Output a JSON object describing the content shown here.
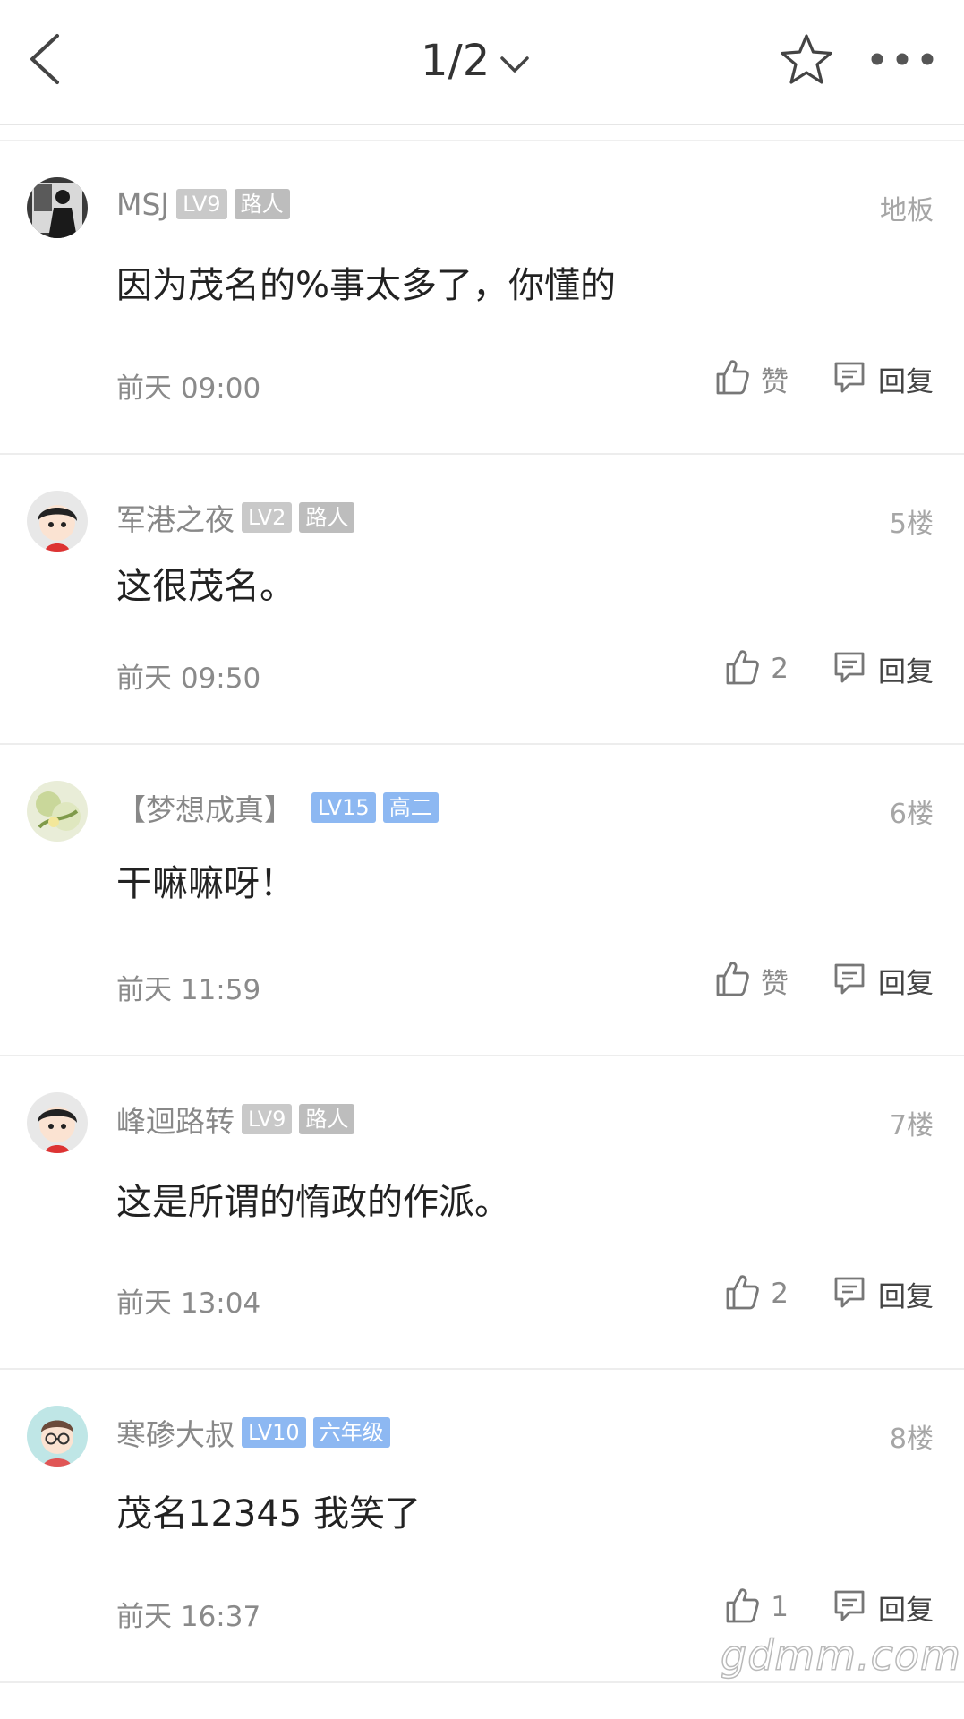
{
  "header": {
    "page_indicator": "1/2",
    "icons": [
      "back-arrow-icon",
      "chevron-down-icon",
      "star-icon",
      "more-dots-icon"
    ]
  },
  "comments": [
    {
      "username": "MSJ",
      "level": "LV9",
      "title": "路人",
      "title_color": "grey",
      "floor": "地板",
      "content": "因为茂名的%事太多了，你懂的",
      "time": "前天 09:00",
      "like": "赞",
      "reply": "回复"
    },
    {
      "username": "军港之夜",
      "level": "LV2",
      "title": "路人",
      "title_color": "grey",
      "floor": "5楼",
      "content": "这很茂名。",
      "time": "前天 09:50",
      "like": "2",
      "reply": "回复"
    },
    {
      "username": "【梦想成真】",
      "level": "LV15",
      "title": "高二",
      "title_color": "blue",
      "floor": "6楼",
      "content": "干嘛嘛呀！",
      "time": "前天 11:59",
      "like": "赞",
      "reply": "回复"
    },
    {
      "username": "峰迴路转",
      "level": "LV9",
      "title": "路人",
      "title_color": "grey",
      "floor": "7楼",
      "content": "这是所谓的惰政的作派。",
      "time": "前天 13:04",
      "like": "2",
      "reply": "回复"
    },
    {
      "username": "寒碜大叔",
      "level": "LV10",
      "title": "六年级",
      "title_color": "blue",
      "floor": "8楼",
      "content": "茂名12345 我笑了",
      "time": "前天 16:37",
      "like": "1",
      "reply": "回复"
    }
  ],
  "watermark": "gdmm.com"
}
